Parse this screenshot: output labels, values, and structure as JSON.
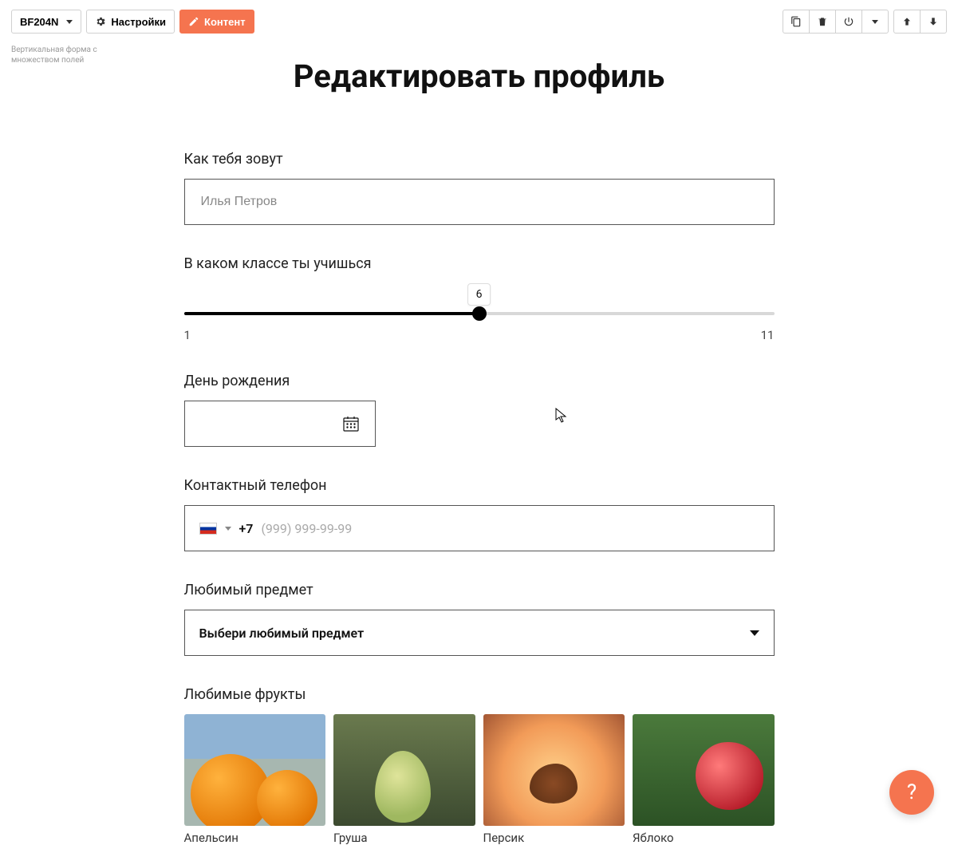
{
  "toolbar": {
    "block_id": "BF204N",
    "settings_label": "Настройки",
    "content_label": "Контент"
  },
  "sidebar_hint": "Вертикальная форма с множеством полей",
  "page_title": "Редактировать профиль",
  "fields": {
    "name": {
      "label": "Как тебя зовут",
      "placeholder": "Илья Петров"
    },
    "grade": {
      "label": "В каком классе ты учишься",
      "min": 1,
      "max": 11,
      "value": 6,
      "min_label": "1",
      "max_label": "11",
      "value_label": "6"
    },
    "birthday": {
      "label": "День рождения"
    },
    "phone": {
      "label": "Контактный телефон",
      "prefix": "+7",
      "placeholder": "(999) 999-99-99"
    },
    "subject": {
      "label": "Любимый предмет",
      "placeholder": "Выбери любимый предмет"
    },
    "fruits": {
      "label": "Любимые фрукты",
      "items": [
        {
          "caption": "Апельсин"
        },
        {
          "caption": "Груша"
        },
        {
          "caption": "Персик"
        },
        {
          "caption": "Яблоко"
        }
      ]
    }
  },
  "help_label": "?"
}
